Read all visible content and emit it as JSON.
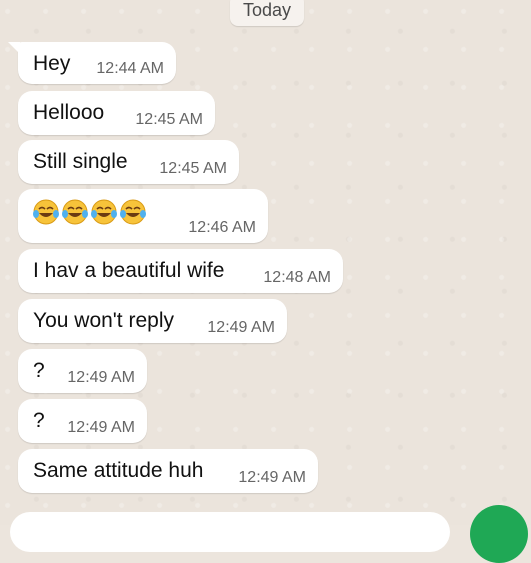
{
  "date_divider": "Today",
  "messages": [
    {
      "text": "Hey",
      "time": "12:44 AM"
    },
    {
      "text": "Hellooo",
      "time": "12:45 AM"
    },
    {
      "text": "Still single",
      "time": "12:45 AM"
    },
    {
      "text": "",
      "emoji": "face-with-tears-of-joy",
      "emoji_count": 4,
      "time": "12:46 AM"
    },
    {
      "text": "I hav a beautiful wife",
      "time": "12:48 AM"
    },
    {
      "text": "You won't reply",
      "time": "12:49 AM"
    },
    {
      "text": "?",
      "time": "12:49 AM"
    },
    {
      "text": "?",
      "time": "12:49 AM"
    },
    {
      "text": "Same attitude huh",
      "time": "12:49 AM"
    }
  ],
  "composer": {
    "send_icon": "mic-icon",
    "accent": "#1fa855"
  },
  "colors": {
    "wallpaper": "#ebe4dc",
    "bubble_in": "#ffffff"
  }
}
